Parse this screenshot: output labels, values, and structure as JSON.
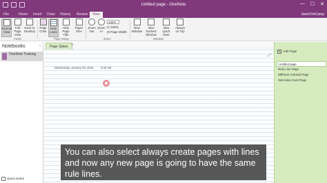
{
  "titlebar": {
    "title": "Untitled page - OneNote",
    "user": "Jared DeCamp",
    "window_buttons": [
      "—",
      "☐",
      "✕"
    ]
  },
  "tabs": [
    "File",
    "Home",
    "Insert",
    "Draw",
    "History",
    "Review",
    "View"
  ],
  "active_tab": "View",
  "ribbon": {
    "buttons": [
      {
        "label": "Normal View",
        "selected": true
      },
      {
        "label": "Full Page View",
        "selected": false
      },
      {
        "label": "Dock to Desktop",
        "selected": false
      },
      {
        "label": "Page Color",
        "selected": false
      },
      {
        "label": "Rule Lines",
        "selected": true
      },
      {
        "label": "Hide Page Title",
        "selected": false
      },
      {
        "label": "Paper Size",
        "selected": false
      },
      {
        "label": "Zoom Out",
        "selected": false
      },
      {
        "label": "Zoom In",
        "selected": false
      },
      {
        "label": "New Window",
        "selected": false
      },
      {
        "label": "New Docked Window",
        "selected": false
      },
      {
        "label": "New Quick Note",
        "selected": false
      },
      {
        "label": "Always on Top",
        "selected": false
      }
    ],
    "zoom_value": "100%",
    "zoom_100": "100%",
    "page_width": "Page Width",
    "groups": [
      "Views",
      "Page Setup",
      "Zoom",
      "Window"
    ]
  },
  "notebooks": {
    "header": "Notebooks",
    "items": [
      "OneNote Training"
    ],
    "quick_notes": "Quick Notes"
  },
  "section": {
    "tab_label": "Page Styles",
    "add_symbol": "+"
  },
  "page": {
    "date": "Wednesday, January 06, 2016",
    "time": "9:40 AM"
  },
  "pages_pane": {
    "add_page": "Add Page",
    "pages": [
      "Untitled page",
      "Rule Line Page",
      "Different Colored Page",
      "3x5 Index Card Page"
    ]
  },
  "caption": {
    "text": "You can also select always create pages with lines and now any new page is going to have the same rule lines."
  },
  "colors": {
    "accent": "#80397b",
    "section_green": "#d6ebbe",
    "cursor": "#e98f98"
  }
}
